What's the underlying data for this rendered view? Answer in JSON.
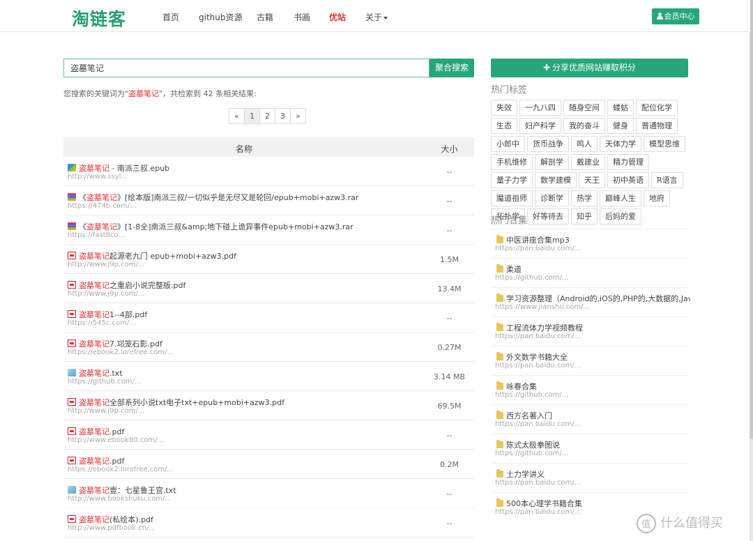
{
  "nav": {
    "logo": "淘链客",
    "items": [
      "首页",
      "github资源",
      "古籍",
      "书画",
      "优站",
      "关于"
    ],
    "member_label": "会员中心"
  },
  "search": {
    "value": "盗墓笔记",
    "button": "聚合搜索",
    "summary_prefix": "您搜索的关键词为\"",
    "summary_keyword": "盗墓笔记",
    "summary_suffix": "\"，共检索到 42 条相关结果:"
  },
  "pagination": [
    "«",
    "1",
    "2",
    "3",
    "»"
  ],
  "table": {
    "headers": {
      "name": "名称",
      "size": "大小"
    },
    "rows": [
      {
        "icon": "epub-icon",
        "hl": "盗墓笔记",
        "pre": "",
        "post": " - 南派三叔.epub",
        "url": "http://www.ssyl...",
        "size": "--"
      },
      {
        "icon": "rar-icon",
        "hl": "盗墓笔记",
        "pre": "《",
        "post": "》[绘本版]南派三叔/一切似乎是无尽又是轮回/epub+mobi+azw3.rar",
        "url": "https://474b.com/...",
        "size": "--"
      },
      {
        "icon": "rar-icon",
        "hl": "盗墓笔记",
        "pre": "《",
        "post": "》[1-8全]南派三叔&amp;地下碰上诡异事件epub+mobi+azw3.rar",
        "url": "https://fast8co...",
        "size": "--"
      },
      {
        "icon": "pdf-icon",
        "hl": "盗墓笔记",
        "pre": "",
        "post": "起源老九门 epub+mobi+azw3.pdf",
        "url": "http://www.j9p.com/...",
        "size": "1.5M"
      },
      {
        "icon": "pdf-icon",
        "hl": "盗墓笔记",
        "pre": "",
        "post": "之重启小说完整版.pdf",
        "url": "http://www.j9p.com/...",
        "size": "13.4M"
      },
      {
        "icon": "pdf-icon",
        "hl": "盗墓笔记",
        "pre": "",
        "post": "1--4部.pdf",
        "url": "https://545c.com/...",
        "size": "--"
      },
      {
        "icon": "pdf-icon",
        "hl": "盗墓笔记",
        "pre": "",
        "post": "7.邛笼石影.pdf",
        "url": "https://ebook2.lorefree.com/...",
        "size": "0.27M"
      },
      {
        "icon": "txt-icon",
        "hl": "盗墓笔记",
        "pre": "",
        "post": ".txt",
        "url": "https://github.com/...",
        "size": "3.14 MB"
      },
      {
        "icon": "pdf-icon",
        "hl": "盗墓笔记",
        "pre": "",
        "post": "全部系列小说txt电子txt+epub+mobi+azw3.pdf",
        "url": "http://www.j9p.com/...",
        "size": "69.5M"
      },
      {
        "icon": "pdf-icon",
        "hl": "盗墓笔记",
        "pre": "",
        "post": ".pdf",
        "url": "http://www.ebook80.com/...",
        "size": "--"
      },
      {
        "icon": "pdf-icon",
        "hl": "盗墓笔记",
        "pre": "",
        "post": ".pdf",
        "url": "https://ebook2.lorefree.com/...",
        "size": "0.2M"
      },
      {
        "icon": "txt-icon",
        "hl": "盗墓笔记",
        "pre": "",
        "post": "壹：七星鲁王宫.txt",
        "url": "http://www.bookshuku.com/...",
        "size": "--"
      },
      {
        "icon": "pdf-icon",
        "hl": "盗墓笔记",
        "pre": "",
        "post": "(私绘本).pdf",
        "url": "http://www.pdfbook.cn/...",
        "size": "--"
      }
    ]
  },
  "sidebar": {
    "share_button": "分享优质网站赚取积分",
    "tags_title": "热门标签",
    "tags": [
      "失效",
      "一九八四",
      "随身空间",
      "蝼蛄",
      "配位化学",
      "生态",
      "妇产科学",
      "我的奋斗",
      "健身",
      "普通物理",
      "小郎中",
      "货币战争",
      "鸣人",
      "天体力学",
      "模型思维",
      "手机维修",
      "解剖学",
      "戴建业",
      "精力管理",
      "量子力学",
      "数学建模",
      "天王",
      "初中英语",
      "R语言",
      "魔道祖师",
      "诊断学",
      "热学",
      "巅峰人生",
      "地府",
      "拓扑学",
      "好等待去",
      "知乎",
      "后妈的爱"
    ],
    "collections_title": "热门合集",
    "collections": [
      {
        "title": "中医讲座合集mp3",
        "url": "https://pan.baidu.com/..."
      },
      {
        "title": "柔道",
        "url": "https://github.com/..."
      },
      {
        "title": "学习资源整理（Android的,iOS的,PHP的,大数据的,Java的,",
        "url": "https://www.jianshu.com/..."
      },
      {
        "title": "工程流体力学视频教程",
        "url": "https://pan.baidu.com/..."
      },
      {
        "title": "外文数学书籍大全",
        "url": "https://pan.baidu.com/..."
      },
      {
        "title": "咏春合集",
        "url": "https://github.com/..."
      },
      {
        "title": "西方名著入门",
        "url": "https://pan.baidu.com/..."
      },
      {
        "title": "陈式太极拳图说",
        "url": "https://github.com/..."
      },
      {
        "title": "土力学讲义",
        "url": "https://pan.baidu.com/..."
      },
      {
        "title": "500本心理学书籍合集",
        "url": "https://pan.baidu.com/..."
      }
    ]
  },
  "watermark": "什么值得买",
  "colors": {
    "accent": "#26a67a",
    "highlight": "#e53030"
  }
}
